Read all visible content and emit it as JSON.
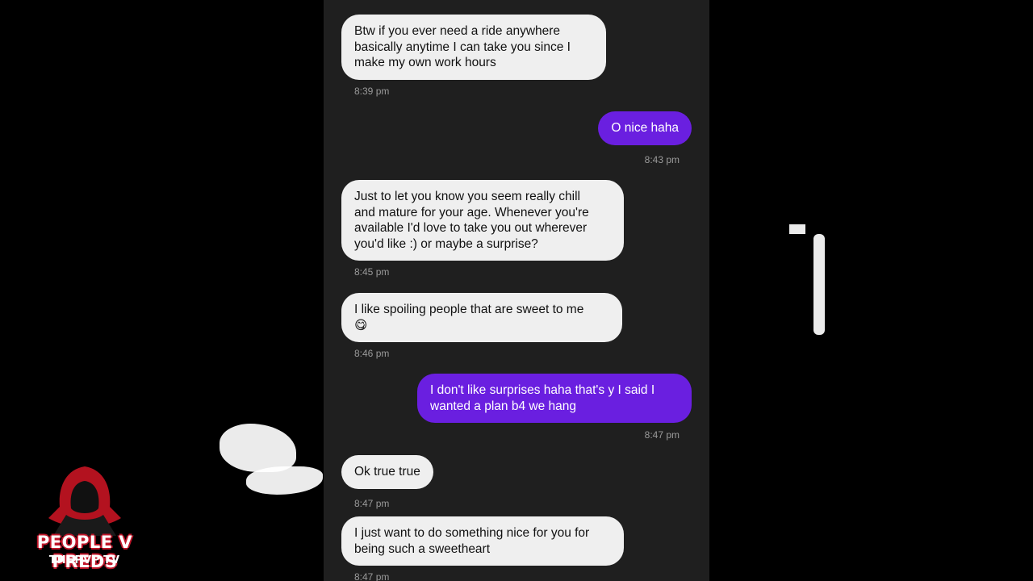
{
  "messages": [
    {
      "direction": "in",
      "text": "Btw if you ever need a ride anywhere\nbasically anytime I can take you since I\nmake my own work hours",
      "time": "8:39 pm"
    },
    {
      "direction": "out",
      "text": "O nice haha",
      "time": "8:43 pm"
    },
    {
      "direction": "in",
      "text": "Just to let you know you seem really chill\nand mature for your age. Whenever you're\navailable I'd love to take you out wherever\nyou'd like :) or maybe a surprise?",
      "time": "8:45 pm"
    },
    {
      "direction": "in",
      "text": "I like spoiling people that are sweet to me\n😋",
      "time": "8:46 pm"
    },
    {
      "direction": "out",
      "text": "I don't like surprises haha that's y I said I\nwanted a plan b4 we hang",
      "time": "8:47 pm"
    },
    {
      "direction": "in",
      "text": "Ok true true",
      "time": "8:47 pm"
    },
    {
      "direction": "in",
      "text": "I just want to do something nice for you for\nbeing such a sweetheart",
      "time": "8:47 pm"
    }
  ],
  "logo": {
    "title": "PEOPLE V PREDS",
    "subtitle": "THEPVP.TV"
  },
  "colors": {
    "outgoing_bubble": "#6a1fe0",
    "incoming_bubble": "#efefef",
    "chat_background": "#1f1f1f"
  }
}
